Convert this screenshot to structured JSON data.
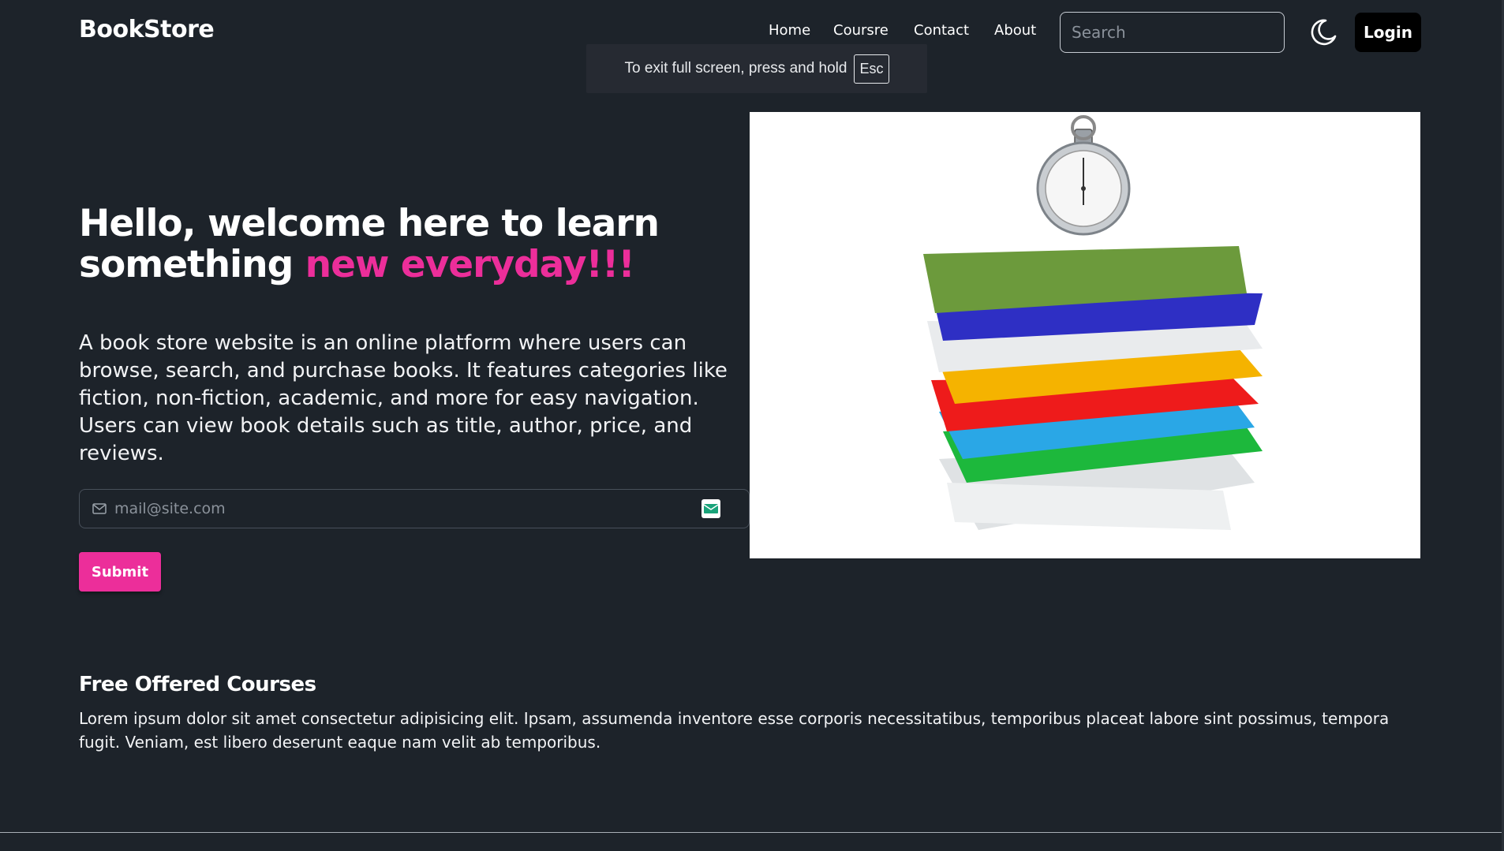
{
  "navbar": {
    "brand": "BookStore",
    "links": [
      "Home",
      "Coursre",
      "Contact",
      "About"
    ],
    "search_placeholder": "Search",
    "login_label": "Login",
    "theme_icon": "moon-icon"
  },
  "fullscreen_toast": {
    "message": "To exit full screen, press and hold",
    "key": "Esc"
  },
  "hero": {
    "title_part1": "Hello, welcome here to learn something ",
    "title_accent": "new everyday!!!",
    "description": "A book store website is an online platform where users can browse, search, and purchase books. It features categories like fiction, non-fiction, academic, and more for easy navigation. Users can view book details such as title, author, price, and reviews.",
    "email_placeholder": "mail@site.com",
    "submit_label": "Submit",
    "image_icon": "books-stack-with-stopwatch-illustration"
  },
  "courses": {
    "title": "Free Offered Courses",
    "text": "Lorem ipsum dolor sit amet consectetur adipisicing elit. Ipsam, assumenda inventore esse corporis necessitatibus, temporibus placeat labore sint possimus, tempora fugit. Veniam, est libero deserunt eaque nam velit ab temporibus."
  },
  "colors": {
    "background": "#1d232a",
    "accent": "#ec2e9a",
    "login_bg": "#000000"
  }
}
